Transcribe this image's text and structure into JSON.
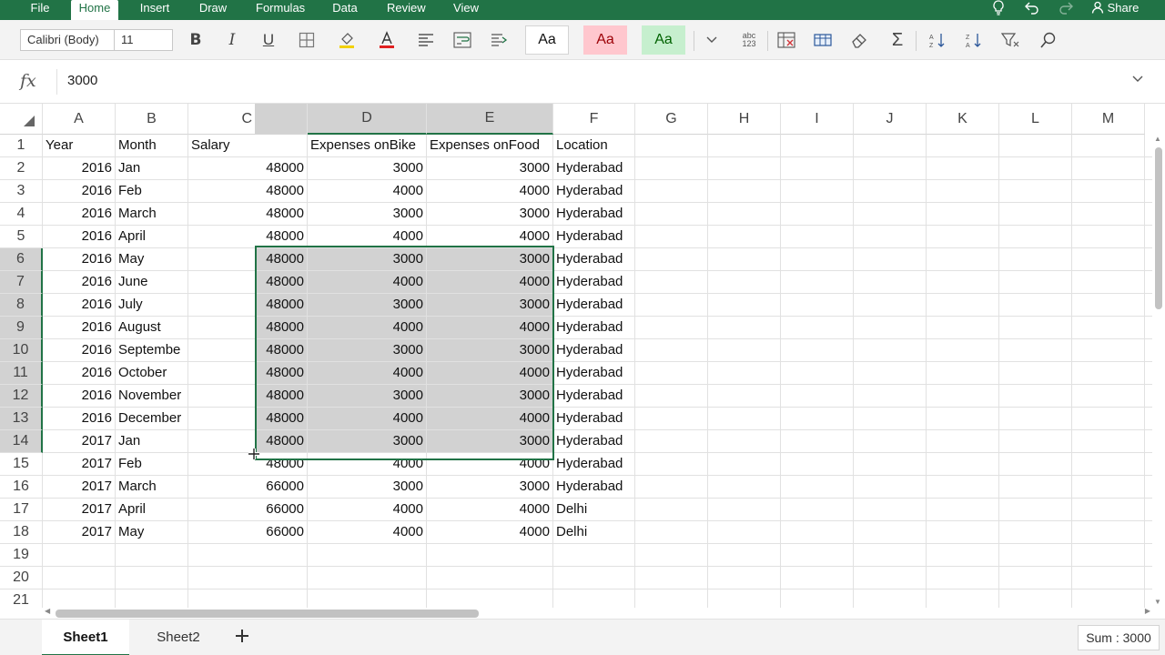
{
  "menu": {
    "items": [
      "File",
      "Home",
      "Insert",
      "Draw",
      "Formulas",
      "Data",
      "Review",
      "View"
    ],
    "active": "Home",
    "share_label": "Share"
  },
  "ribbon": {
    "font_name": "Calibri (Body)",
    "font_size": "11",
    "style_normal": "Aa",
    "style_bad": "Aa",
    "style_good": "Aa",
    "abc_label": "abc\n123"
  },
  "formula_bar": {
    "fx_label": "fx",
    "value": "3000"
  },
  "columns": [
    "A",
    "B",
    "C",
    "D",
    "E",
    "F",
    "G",
    "H",
    "I",
    "J",
    "K",
    "L",
    "M"
  ],
  "rows": [
    {
      "n": "1",
      "cells": [
        "Year",
        "Month",
        "Salary",
        "Expenses onBike",
        "Expenses onFood",
        "Location"
      ]
    },
    {
      "n": "2",
      "cells": [
        "2016",
        "Jan",
        "48000",
        "3000",
        "3000",
        "Hyderabad"
      ]
    },
    {
      "n": "3",
      "cells": [
        "2016",
        "Feb",
        "48000",
        "4000",
        "4000",
        "Hyderabad"
      ]
    },
    {
      "n": "4",
      "cells": [
        "2016",
        "March",
        "48000",
        "3000",
        "3000",
        "Hyderabad"
      ]
    },
    {
      "n": "5",
      "cells": [
        "2016",
        "April",
        "48000",
        "4000",
        "4000",
        "Hyderabad"
      ]
    },
    {
      "n": "6",
      "cells": [
        "2016",
        "May",
        "48000",
        "3000",
        "3000",
        "Hyderabad"
      ]
    },
    {
      "n": "7",
      "cells": [
        "2016",
        "June",
        "48000",
        "4000",
        "4000",
        "Hyderabad"
      ]
    },
    {
      "n": "8",
      "cells": [
        "2016",
        "July",
        "48000",
        "3000",
        "3000",
        "Hyderabad"
      ]
    },
    {
      "n": "9",
      "cells": [
        "2016",
        "August",
        "48000",
        "4000",
        "4000",
        "Hyderabad"
      ]
    },
    {
      "n": "10",
      "cells": [
        "2016",
        "Septembe",
        "48000",
        "3000",
        "3000",
        "Hyderabad"
      ]
    },
    {
      "n": "11",
      "cells": [
        "2016",
        "October",
        "48000",
        "4000",
        "4000",
        "Hyderabad"
      ]
    },
    {
      "n": "12",
      "cells": [
        "2016",
        "November",
        "48000",
        "3000",
        "3000",
        "Hyderabad"
      ]
    },
    {
      "n": "13",
      "cells": [
        "2016",
        "December",
        "48000",
        "4000",
        "4000",
        "Hyderabad"
      ]
    },
    {
      "n": "14",
      "cells": [
        "2017",
        "Jan",
        "48000",
        "3000",
        "3000",
        "Hyderabad"
      ]
    },
    {
      "n": "15",
      "cells": [
        "2017",
        "Feb",
        "48000",
        "4000",
        "4000",
        "Hyderabad"
      ]
    },
    {
      "n": "16",
      "cells": [
        "2017",
        "March",
        "66000",
        "3000",
        "3000",
        "Hyderabad"
      ]
    },
    {
      "n": "17",
      "cells": [
        "2017",
        "April",
        "66000",
        "4000",
        "4000",
        "Delhi"
      ]
    },
    {
      "n": "18",
      "cells": [
        "2017",
        "May",
        "66000",
        "4000",
        "4000",
        "Delhi"
      ]
    },
    {
      "n": "19",
      "cells": [
        "",
        "",
        "",
        "",
        "",
        ""
      ]
    },
    {
      "n": "20",
      "cells": [
        "",
        "",
        "",
        "",
        "",
        ""
      ]
    },
    {
      "n": "21",
      "cells": [
        "",
        "",
        "",
        "",
        "",
        ""
      ]
    }
  ],
  "selection": {
    "range": "C6:E14",
    "selected_columns": [
      "D",
      "E"
    ],
    "selected_rows": [
      "6",
      "7",
      "8",
      "9",
      "10",
      "11",
      "12",
      "13",
      "14"
    ]
  },
  "sheets": [
    "Sheet1",
    "Sheet2"
  ],
  "active_sheet": "Sheet1",
  "status": {
    "sum_label": "Sum : 3000"
  },
  "colors": {
    "accent": "#217346",
    "selection_fill": "#d2d2d2",
    "bad_fill": "#ffc7ce",
    "bad_text": "#9c0006",
    "good_fill": "#c6efce",
    "good_text": "#006100"
  }
}
